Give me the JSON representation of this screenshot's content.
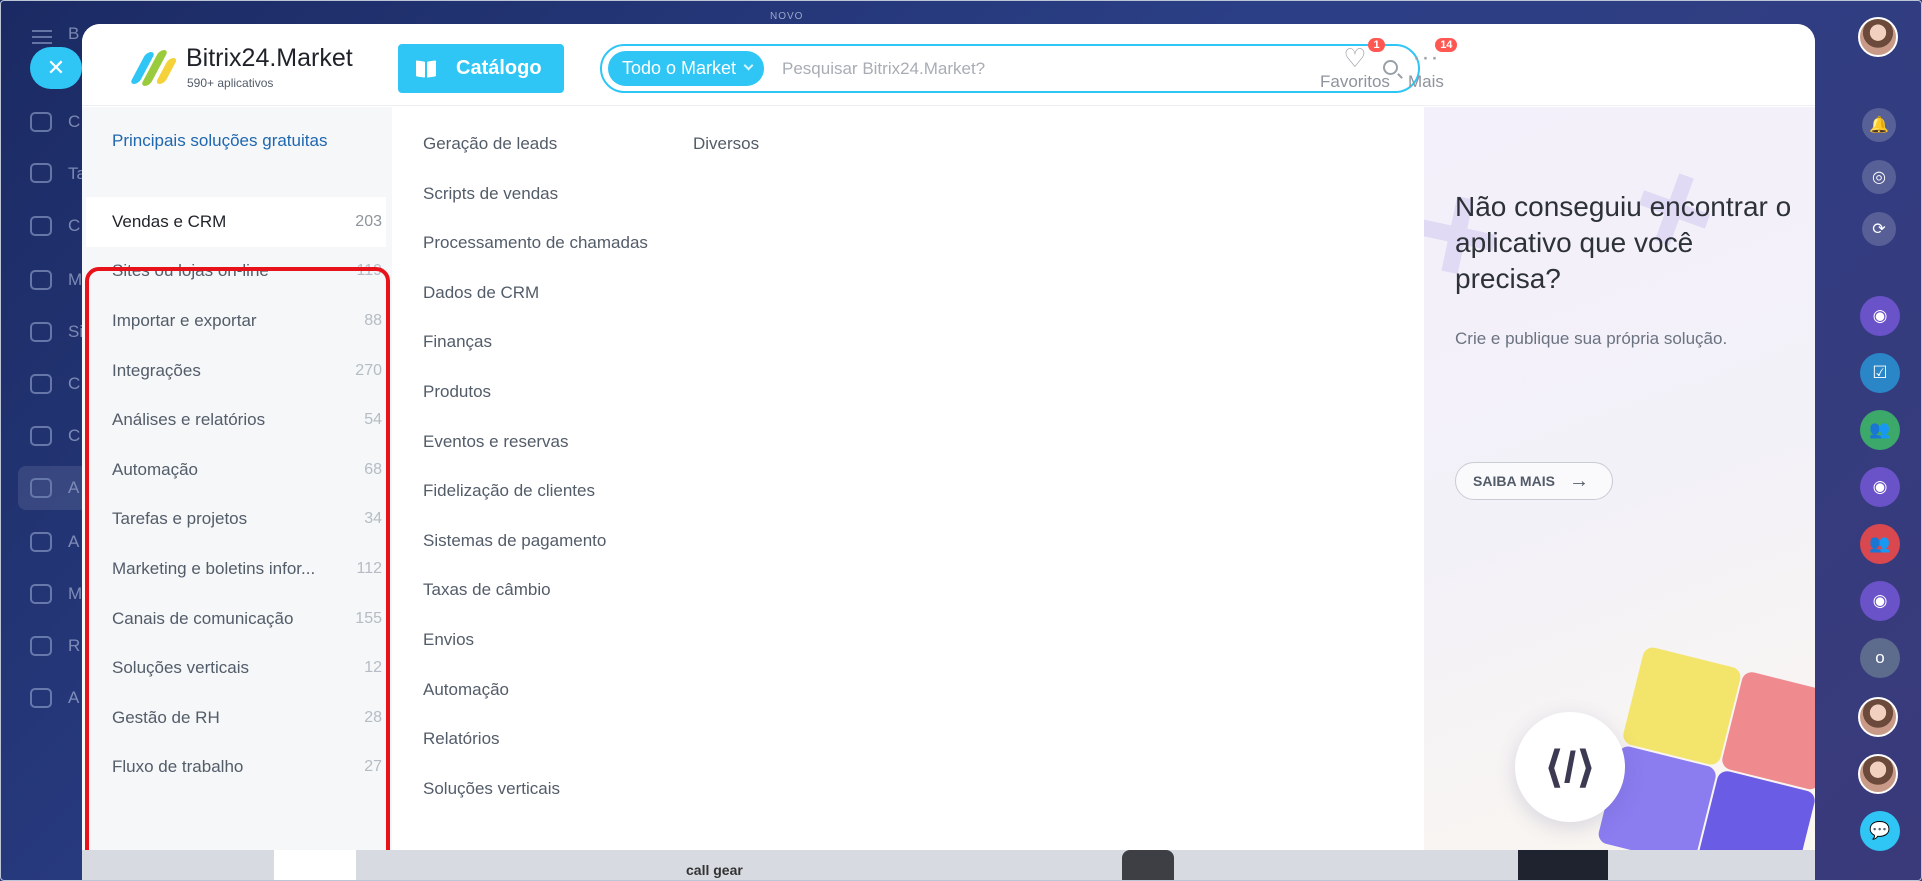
{
  "background": {
    "banner_label": "NOVO",
    "letters": [
      "B",
      "C",
      "Ta",
      "C",
      "M",
      "Si",
      "C",
      "C",
      "A",
      "A",
      "M",
      "R",
      "A"
    ]
  },
  "header": {
    "logo_title": "Bitrix24.Market",
    "logo_subtitle": "590+ aplicativos",
    "catalog_label": "Catálogo",
    "search_scope": "Todo o Market",
    "search_placeholder": "Pesquisar Bitrix24.Market?",
    "favorites_label": "Favoritos",
    "favorites_badge": "1",
    "more_label": "Mais",
    "more_badge": "14"
  },
  "sidebar": {
    "top_link": "Principais soluções gratuitas",
    "categories": [
      {
        "label": "Vendas e CRM",
        "count": "203",
        "active": true
      },
      {
        "label": "Sites ou lojas on-line",
        "count": "119"
      },
      {
        "label": "Importar e exportar",
        "count": "88"
      },
      {
        "label": "Integrações",
        "count": "270"
      },
      {
        "label": "Análises e relatórios",
        "count": "54"
      },
      {
        "label": "Automação",
        "count": "68"
      },
      {
        "label": "Tarefas e projetos",
        "count": "34"
      },
      {
        "label": "Marketing e boletins infor...",
        "count": "112"
      },
      {
        "label": "Canais de comunicação",
        "count": "155"
      },
      {
        "label": "Soluções verticais",
        "count": "12"
      },
      {
        "label": "Gestão de RH",
        "count": "28"
      },
      {
        "label": "Fluxo de trabalho",
        "count": "27"
      }
    ]
  },
  "subcategories": [
    "Geração de leads",
    "Scripts de vendas",
    "Processamento de chamadas",
    "Dados de CRM",
    "Finanças",
    "Produtos",
    "Eventos e reservas",
    "Fidelização de clientes",
    "Sistemas de pagamento",
    "Taxas de câmbio",
    "Envios",
    "Automação",
    "Relatórios",
    "Soluções verticais"
  ],
  "subcategories_col2": [
    "Diversos"
  ],
  "promo": {
    "title": "Não conseguiu encontrar o aplicativo que você precisa?",
    "subtitle": "Crie e publique sua própria solução.",
    "button_label": "SAIBA MAIS"
  },
  "rail": {
    "user_initial": "o"
  },
  "bottom_strip": {
    "brand_text": "call gear"
  },
  "colors": {
    "accent": "#2fc6f6",
    "highlight": "#e8121a",
    "badge": "#ff5752",
    "link": "#2067b0"
  }
}
